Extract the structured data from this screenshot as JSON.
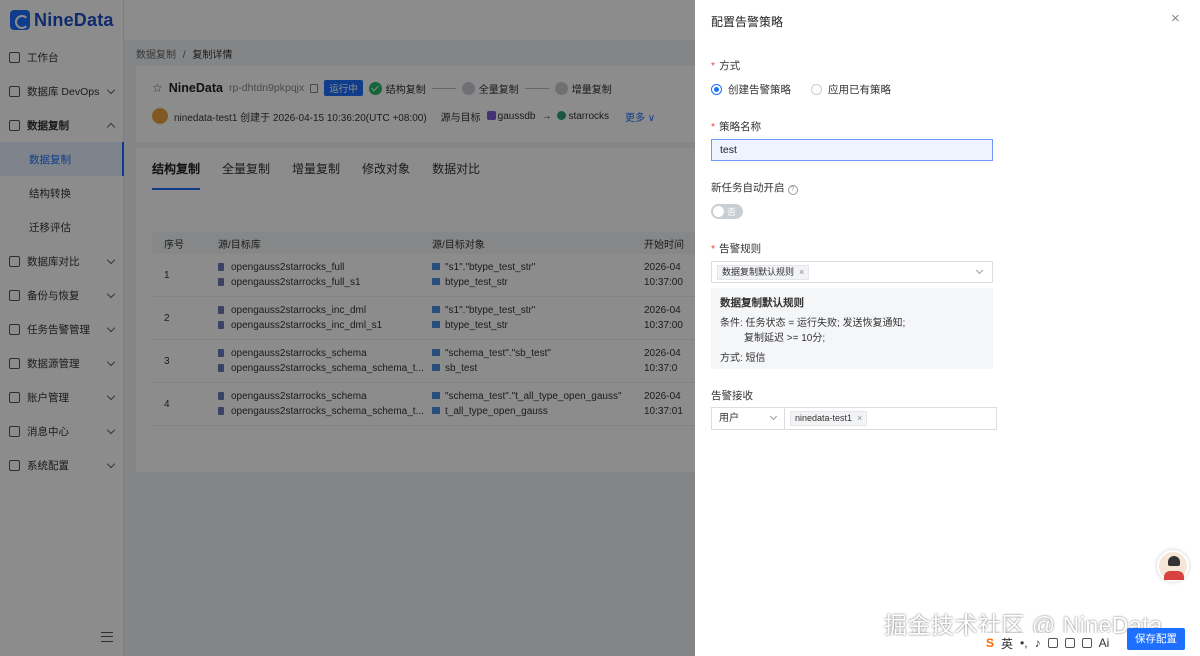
{
  "logo": "NineData",
  "sidebar": {
    "items": [
      {
        "label": "工作台"
      },
      {
        "label": "数据库 DevOps"
      },
      {
        "label": "数据复制"
      },
      {
        "label": "数据复制"
      },
      {
        "label": "结构转换"
      },
      {
        "label": "迁移评估"
      },
      {
        "label": "数据库对比"
      },
      {
        "label": "备份与恢复"
      },
      {
        "label": "任务告警管理"
      },
      {
        "label": "数据源管理"
      },
      {
        "label": "账户管理"
      },
      {
        "label": "消息中心"
      },
      {
        "label": "系统配置"
      }
    ]
  },
  "breadcrumb": {
    "parent": "数据复制",
    "sep": "/",
    "current": "复制详情"
  },
  "task": {
    "name": "NineData",
    "id": "rp-dhtdn9pkpqjx",
    "status": "运行中",
    "steps": [
      "结构复制",
      "全量复制",
      "增量复制"
    ],
    "creator": "ninedata-test1 创建于 2026-04-15 10:36:20(UTC +08:00)",
    "src_dst_label": "源与目标",
    "source": "gaussdb",
    "arrow": "→",
    "target": "starrocks",
    "more": "更多"
  },
  "tabs": [
    "结构复制",
    "全量复制",
    "增量复制",
    "修改对象",
    "数据对比"
  ],
  "table": {
    "headers": [
      "序号",
      "源/目标库",
      "源/目标对象",
      "开始时间"
    ],
    "rows": [
      {
        "no": "1",
        "db1": "opengauss2starrocks_full",
        "db2": "opengauss2starrocks_full_s1",
        "obj1": "\"s1\".\"btype_test_str\"",
        "obj2": "btype_test_str",
        "t1": "2026-04",
        "t2": "10:37:00"
      },
      {
        "no": "2",
        "db1": "opengauss2starrocks_inc_dml",
        "db2": "opengauss2starrocks_inc_dml_s1",
        "obj1": "\"s1\".\"btype_test_str\"",
        "obj2": "btype_test_str",
        "t1": "2026-04",
        "t2": "10:37:00"
      },
      {
        "no": "3",
        "db1": "opengauss2starrocks_schema",
        "db2": "opengauss2starrocks_schema_schema_t...",
        "obj1": "\"schema_test\".\"sb_test\"",
        "obj2": "sb_test",
        "t1": "2026-04",
        "t2": "10:37:0"
      },
      {
        "no": "4",
        "db1": "opengauss2starrocks_schema",
        "db2": "opengauss2starrocks_schema_schema_t...",
        "obj1": "\"schema_test\".\"t_all_type_open_gauss\"",
        "obj2": "t_all_type_open_gauss",
        "t1": "2026-04",
        "t2": "10:37:01"
      }
    ]
  },
  "drawer": {
    "title": "配置告警策略",
    "close": "×",
    "mode_label": "方式",
    "mode_options": [
      "创建告警策略",
      "应用已有策略"
    ],
    "name_label": "策略名称",
    "name_value": "test",
    "auto_label": "新任务自动开启",
    "toggle_text": "否",
    "rules_label": "告警规则",
    "rule_chip": "数据复制默认规则",
    "rule_box": {
      "title": "数据复制默认规则",
      "line1": "条件: 任务状态 = 运行失败; 发送恢复通知;",
      "line2": "复制延迟 >= 10分;",
      "line3": "方式: 短信"
    },
    "receive_label": "告警接收",
    "receive_type": "用户",
    "receive_user": "ninedata-test1",
    "save": "保存配置"
  },
  "watermark": "掘金技术社区 @ NineData",
  "ime": {
    "logo": "S",
    "lang": "英",
    "ai": "Ai"
  }
}
